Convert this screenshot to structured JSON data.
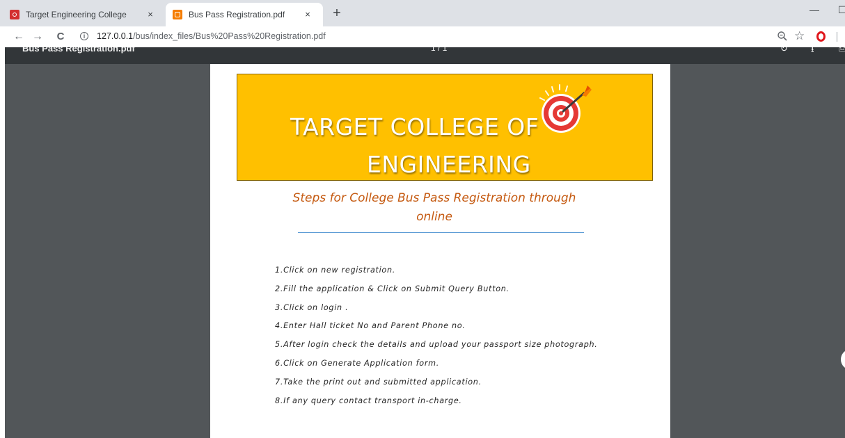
{
  "browser": {
    "tabs": [
      {
        "title": "Target Engineering College",
        "active": false,
        "favicon": "college-favicon-icon"
      },
      {
        "title": "Bus Pass Registration.pdf",
        "active": true,
        "favicon": "pdf-favicon-icon"
      }
    ],
    "close_glyph": "×",
    "new_tab_glyph": "+",
    "url_host": "127.0.0.1",
    "url_path": "/bus/index_files/Bus%20Pass%20Registration.pdf",
    "info_glyph": "i"
  },
  "pdf_viewer": {
    "title": "Bus Pass Registration.pdf",
    "page_indicator": "1 / 1"
  },
  "document": {
    "banner_line1": "TARGET COLLEGE OF",
    "banner_line2": "ENGINEERING",
    "heading": "Steps for College Bus Pass Registration through online",
    "steps": [
      "1.Click on new registration.",
      "2.Fill the application & Click on Submit Query Button.",
      "3.Click on login .",
      "4.Enter Hall ticket No and Parent Phone no.",
      "5.After login check the details and upload your passport size photograph.",
      "6.Click on Generate Application form.",
      "7.Take the print out and submitted application.",
      "8.If any query contact transport in-charge."
    ]
  },
  "colors": {
    "banner_bg": "#ffc000",
    "heading": "#c55a11",
    "viewer_bg": "#525659",
    "viewer_toolbar": "#323639",
    "rule": "#5b9bd5"
  }
}
